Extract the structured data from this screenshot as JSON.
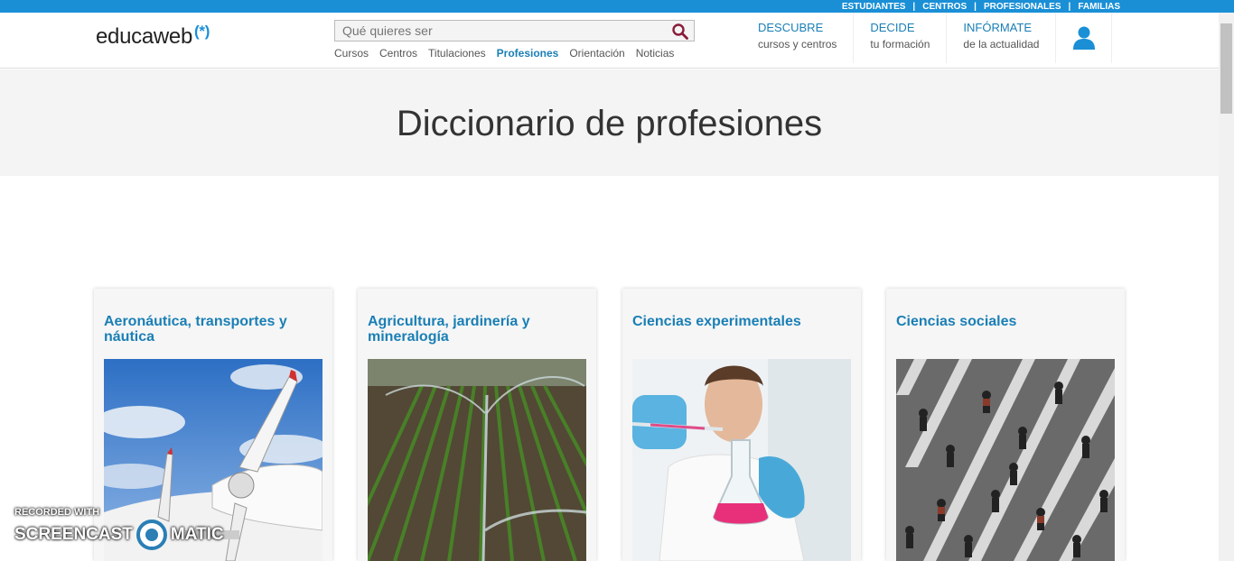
{
  "topbar": {
    "links": [
      "ESTUDIANTES",
      "CENTROS",
      "PROFESIONALES",
      "FAMILIAS"
    ]
  },
  "header": {
    "logo_text": "educaweb",
    "logo_mark": "(*)",
    "search": {
      "placeholder": "Qué quieres ser",
      "icon": "search-icon"
    },
    "subnav": [
      "Cursos",
      "Centros",
      "Titulaciones",
      "Profesiones",
      "Orientación",
      "Noticias"
    ],
    "subnav_active": "Profesiones",
    "mainnav": [
      {
        "title": "DESCUBRE",
        "subtitle": "cursos y centros"
      },
      {
        "title": "DECIDE",
        "subtitle": "tu formación"
      },
      {
        "title": "INFÓRMATE",
        "subtitle": "de la actualidad"
      }
    ],
    "user_icon": "user-icon"
  },
  "hero": {
    "title": "Diccionario de profesiones"
  },
  "cards": [
    {
      "title": "Aeronáutica, transportes y náutica",
      "image": "airplane-propeller-image"
    },
    {
      "title": "Agricultura, jardinería y mineralogía",
      "image": "field-irrigation-image"
    },
    {
      "title": "Ciencias experimentales",
      "image": "lab-scientist-image"
    },
    {
      "title": "Ciencias sociales",
      "image": "crowd-crosswalk-image"
    }
  ],
  "watermark": {
    "line1": "RECORDED WITH",
    "line2a": "SCREENCAST",
    "line2b": "MATIC"
  },
  "colors": {
    "accent": "#1a8fd6",
    "link": "#1a7fb5",
    "hero_bg": "#f4f4f4"
  }
}
